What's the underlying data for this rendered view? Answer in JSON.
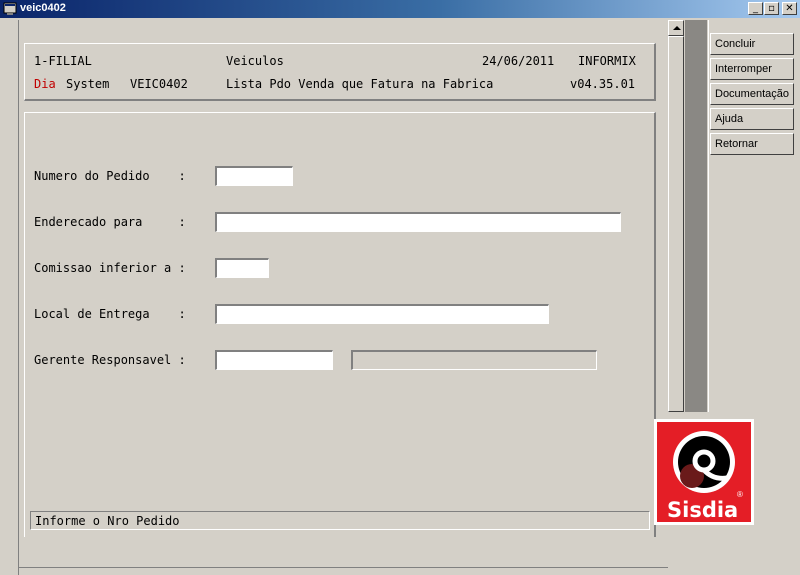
{
  "window": {
    "title": "veic0402",
    "minimize": "_",
    "restore": "▫",
    "close": "✕"
  },
  "header": {
    "filial": "1-FILIAL",
    "module": "Veiculos",
    "date": "24/06/2011",
    "db": "INFORMIX",
    "brand_red": "Dia",
    "brand_rest": "System",
    "program": "VEIC0402",
    "description": "Lista Pdo Venda que Fatura na Fabrica",
    "version": "v04.35.01"
  },
  "form": {
    "pedido": {
      "label": "Numero do Pedido    :",
      "value": ""
    },
    "endereco": {
      "label": "Enderecado para     :",
      "value": ""
    },
    "comissao": {
      "label": "Comissao inferior a :",
      "value": ""
    },
    "local": {
      "label": "Local de Entrega    :",
      "value": ""
    },
    "gerente": {
      "label": "Gerente Responsavel :",
      "value": "",
      "desc": ""
    }
  },
  "status": {
    "message": "Informe o Nro Pedido"
  },
  "actions": [
    "Concluir",
    "Interromper",
    "Documentação",
    "Ajuda",
    "Retornar"
  ],
  "logo": {
    "text": "Sisdia",
    "mark": "®"
  },
  "colors": {
    "brand_red": "#e41e26",
    "title_bar": "#0a246a"
  }
}
